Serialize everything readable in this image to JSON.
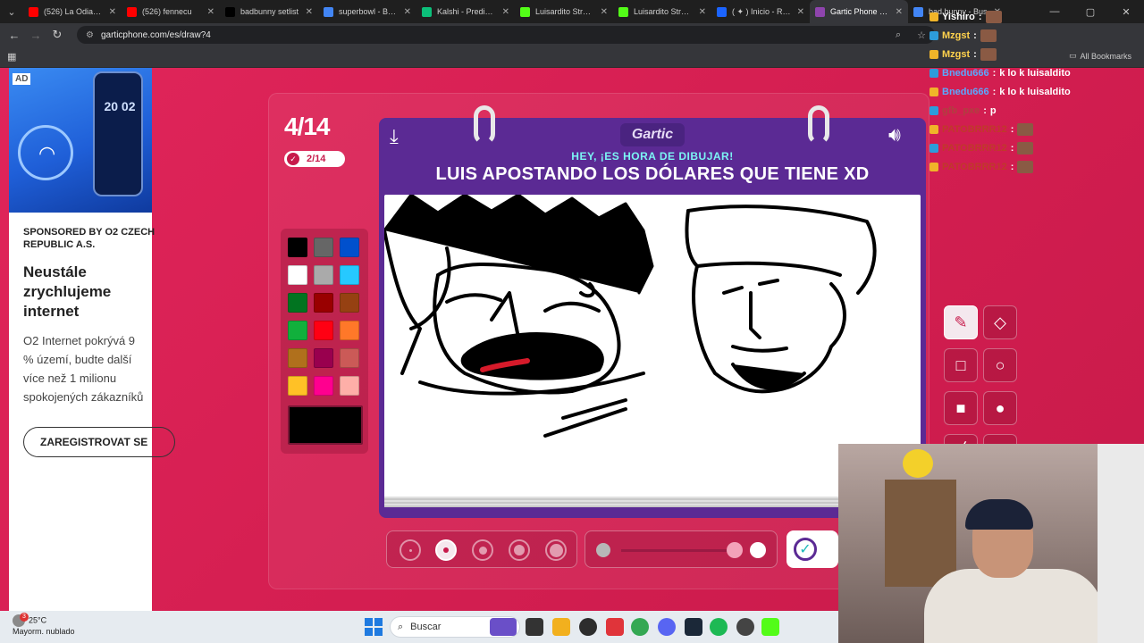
{
  "browser": {
    "tabs": [
      {
        "title": "(526) La Odian Po",
        "fav": "#ff0000",
        "active": false
      },
      {
        "title": "(526) fennecu",
        "fav": "#ff0000",
        "active": false
      },
      {
        "title": "badbunny setlist",
        "fav": "#000000",
        "active": false
      },
      {
        "title": "superbowl - Busca",
        "fav": "#4285f4",
        "active": false
      },
      {
        "title": "Kalshi - Prediction",
        "fav": "#0cbf7a",
        "active": false
      },
      {
        "title": "Luisardito Stream",
        "fav": "#53fc18",
        "active": false
      },
      {
        "title": "Luisardito Stream",
        "fav": "#53fc18",
        "active": false
      },
      {
        "title": "( ✦ ) Inicio - Roblo",
        "fav": "#1b64ff",
        "active": false
      },
      {
        "title": "Gartic Phone - Tel",
        "fav": "#8e44ad",
        "active": true
      },
      {
        "title": "bad bunny - Bus",
        "fav": "#4285f4",
        "active": false
      }
    ],
    "url": "garticphone.com/es/draw?4",
    "all_bookmarks": "All Bookmarks"
  },
  "ad": {
    "tag": "AD",
    "device_time": "20 02",
    "sponsor": "SPONSORED BY O2 CZECH REPUBLIC A.S.",
    "headline": "Neustále zrychlujeme internet",
    "body_lines": [
      "O2 Internet pokrývá 9",
      "% území, budte další",
      "více než 1 milionu",
      "spokojených zákazníků"
    ],
    "cta": "ZAREGISTROVAT SE"
  },
  "game": {
    "round": "4/14",
    "done": "2/14",
    "logo": "Gartic",
    "hint": "HEY, ¡ES HORA DE DIBUJAR!",
    "prompt": "LUIS APOSTANDO LOS DÓLARES QUE TIENE XD",
    "colors": [
      "#000000",
      "#666666",
      "#0050cd",
      "#ffffff",
      "#aaaaaa",
      "#26c9ff",
      "#017420",
      "#990000",
      "#964112",
      "#11b03c",
      "#ff0013",
      "#ff7829",
      "#b0701c",
      "#99004e",
      "#cb5a57",
      "#ffc126",
      "#ff008f",
      "#feafa8"
    ],
    "current_color": "#000000",
    "brush_size_selected": 2,
    "opacity": 1.0
  },
  "chat": [
    {
      "name": "Yishiro",
      "text": "",
      "color": "#ffffff",
      "emote": true
    },
    {
      "name": "Mzgst",
      "text": "",
      "color": "#ffd24d",
      "emote": true
    },
    {
      "name": "Mzgst",
      "text": "",
      "color": "#ffd24d",
      "emote": true
    },
    {
      "name": "Bnedu666",
      "text": "k lo k luisaldito",
      "color": "#5aa9ff",
      "emote": false
    },
    {
      "name": "Bnedu666",
      "text": "k lo k luisaldito",
      "color": "#5aa9ff",
      "emote": false
    },
    {
      "name": "gfb_pxe",
      "text": "p",
      "color": "#b04040",
      "emote": false
    },
    {
      "name": "PATOBRRR12",
      "text": "",
      "color": "#c0392b",
      "emote": true
    },
    {
      "name": "PATOBRRR12",
      "text": "",
      "color": "#c0392b",
      "emote": true
    },
    {
      "name": "PATOBRRR12",
      "text": "",
      "color": "#c0392b",
      "emote": true
    }
  ],
  "taskbar": {
    "temp": "25°C",
    "weather": "Mayorm. nublado",
    "weather_badge": "3",
    "search": "Buscar"
  }
}
